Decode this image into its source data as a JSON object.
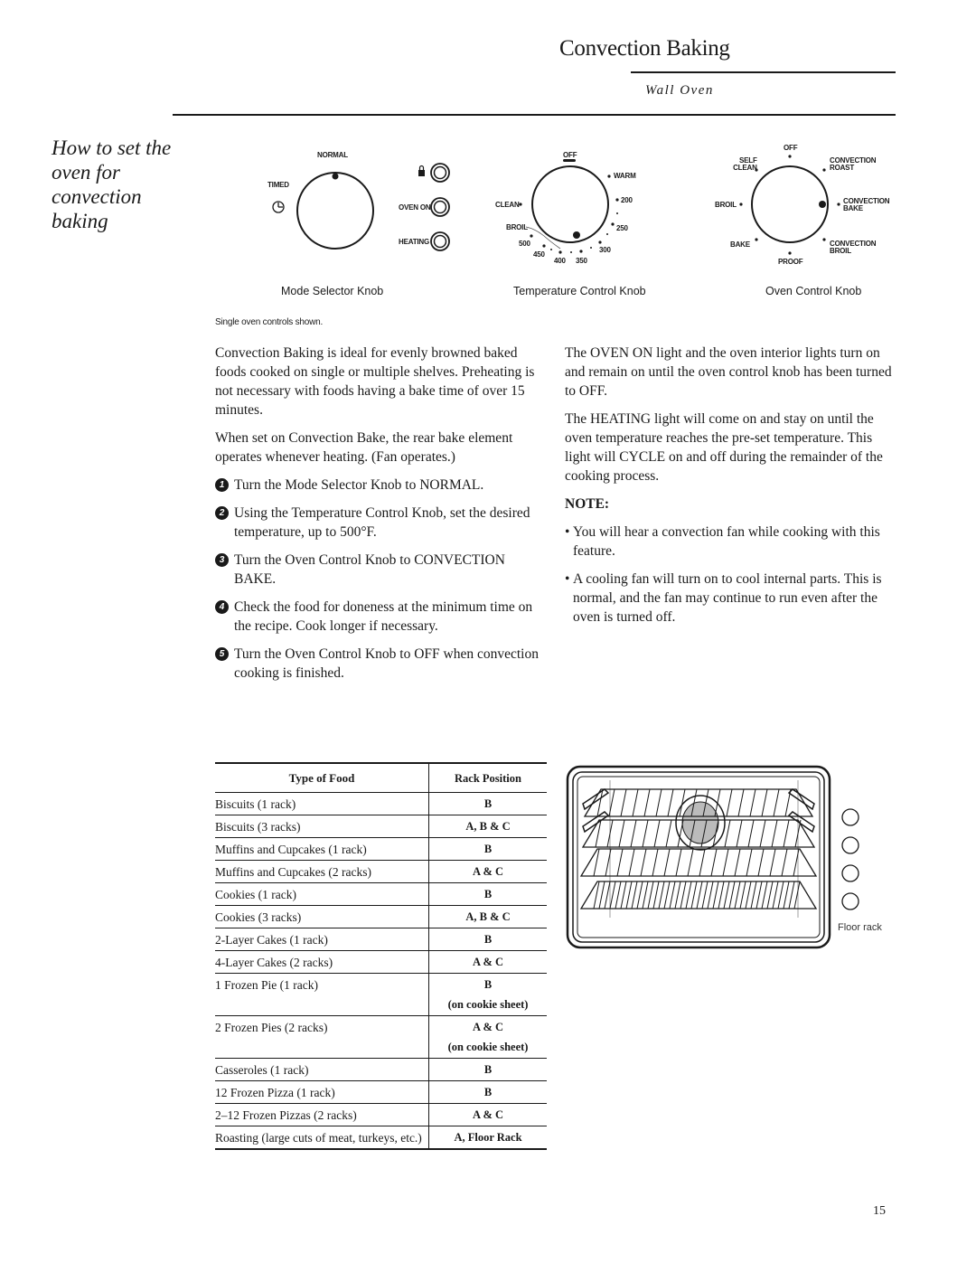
{
  "header": {
    "title": "Convection Baking",
    "subtitle": "Wall Oven"
  },
  "side_heading": "How to set the oven for convection baking",
  "controls": {
    "mode_selector": {
      "caption": "Mode Selector Knob",
      "labels": {
        "normal": "NORMAL",
        "timed": "TIMED"
      },
      "indicators": [
        {
          "label": "",
          "icon": "lock-icon"
        },
        {
          "label": "OVEN ON"
        },
        {
          "label": "HEATING"
        }
      ]
    },
    "temperature": {
      "caption": "Temperature Control Knob",
      "labels": {
        "off": "OFF",
        "warm": "WARM",
        "t200": "200",
        "t250": "250",
        "t300": "300",
        "t350": "350",
        "t400": "400",
        "t450": "450",
        "t500": "500",
        "broil": "BROIL",
        "clean": "CLEAN"
      }
    },
    "oven_control": {
      "caption": "Oven Control Knob",
      "labels": {
        "off": "OFF",
        "self_clean_1": "SELF",
        "self_clean_2": "CLEAN",
        "conv_roast_1": "CONVECTION",
        "conv_roast_2": "ROAST",
        "broil": "BROIL",
        "conv_bake_1": "CONVECTION",
        "conv_bake_2": "BAKE",
        "bake": "BAKE",
        "conv_broil_1": "CONVECTION",
        "conv_broil_2": "BROIL",
        "proof": "PROOF"
      }
    },
    "note": "Single oven controls shown."
  },
  "left_column": {
    "paragraphs": [
      "Convection Baking is ideal for evenly browned baked foods cooked on single or multiple shelves. Preheating is not necessary with foods having a bake time of over 15 minutes.",
      "When set on Convection Bake, the rear bake element operates whenever heating. (Fan operates.)"
    ],
    "steps": [
      {
        "num": "1",
        "text": "Turn the Mode Selector Knob to NORMAL."
      },
      {
        "num": "2",
        "text": "Using the Temperature Control Knob, set the desired temperature, up to 500°F."
      },
      {
        "num": "3",
        "text": "Turn the Oven Control Knob to CONVECTION BAKE."
      },
      {
        "num": "4",
        "text": "Check the food for doneness at the minimum time on the recipe. Cook longer if necessary."
      },
      {
        "num": "5",
        "text": "Turn the Oven Control Knob to OFF when convection cooking is finished."
      }
    ]
  },
  "right_column": {
    "paragraphs": [
      "The OVEN ON light and the oven interior lights turn on and remain on until the oven control knob has been turned to OFF.",
      "The HEATING light will come on and stay on until the oven temperature reaches the pre-set temperature. This light will CYCLE on and off during the remainder of the cooking process."
    ],
    "note_heading": "NOTE:",
    "bullets": [
      "You will hear a convection fan while cooking with this feature.",
      "A cooling fan will turn on to cool internal parts. This is normal, and the fan may continue to run even after the oven is turned off."
    ]
  },
  "rack_table": {
    "headers": [
      "Type of Food",
      "Rack Position"
    ],
    "rows": [
      {
        "food": "Biscuits (1 rack)",
        "position": "B",
        "note": ""
      },
      {
        "food": "Biscuits (3 racks)",
        "position": "A, B & C",
        "note": ""
      },
      {
        "food": "Muffins and Cupcakes (1 rack)",
        "position": "B",
        "note": ""
      },
      {
        "food": "Muffins and Cupcakes (2 racks)",
        "position": "A & C",
        "note": ""
      },
      {
        "food": "Cookies (1 rack)",
        "position": "B",
        "note": ""
      },
      {
        "food": "Cookies (3 racks)",
        "position": "A, B & C",
        "note": ""
      },
      {
        "food": "2-Layer Cakes (1 rack)",
        "position": "B",
        "note": ""
      },
      {
        "food": "4-Layer Cakes (2 racks)",
        "position": "A & C",
        "note": ""
      },
      {
        "food": "1 Frozen Pie (1 rack)",
        "position": "B",
        "note": "(on cookie sheet)"
      },
      {
        "food": "2 Frozen Pies (2 racks)",
        "position": "A & C",
        "note": "(on cookie sheet)"
      },
      {
        "food": "Casseroles (1 rack)",
        "position": "B",
        "note": ""
      },
      {
        "food": "12  Frozen Pizza (1 rack)",
        "position": "B",
        "note": ""
      },
      {
        "food": "2–12  Frozen Pizzas (2 racks)",
        "position": "A & C",
        "note": ""
      },
      {
        "food": "Roasting (large cuts of meat, turkeys, etc.)",
        "position": "A, Floor Rack",
        "note": ""
      }
    ]
  },
  "oven_illustration": {
    "floor_rack_label": "Floor rack"
  },
  "page_number": "15"
}
